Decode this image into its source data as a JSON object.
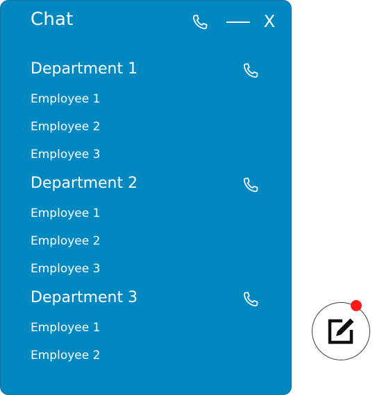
{
  "colors": {
    "panel_bg": "#0288c1",
    "text": "#ffffff",
    "badge": "#ff1a1a"
  },
  "header": {
    "title": "Chat",
    "call_icon": "phone-icon",
    "minimize_icon": "minimize-icon",
    "close_label": "X"
  },
  "departments": [
    {
      "label": "Department 1",
      "call_icon": "phone-icon",
      "employees": [
        "Employee 1",
        "Employee 2",
        "Employee 3"
      ]
    },
    {
      "label": "Department 2",
      "call_icon": "phone-icon",
      "employees": [
        "Employee 1",
        "Employee 2",
        "Employee 3"
      ]
    },
    {
      "label": "Department 3",
      "call_icon": "phone-icon",
      "employees": [
        "Employee 1",
        "Employee 2"
      ]
    }
  ],
  "compose": {
    "icon": "compose-icon",
    "has_notification": true
  }
}
